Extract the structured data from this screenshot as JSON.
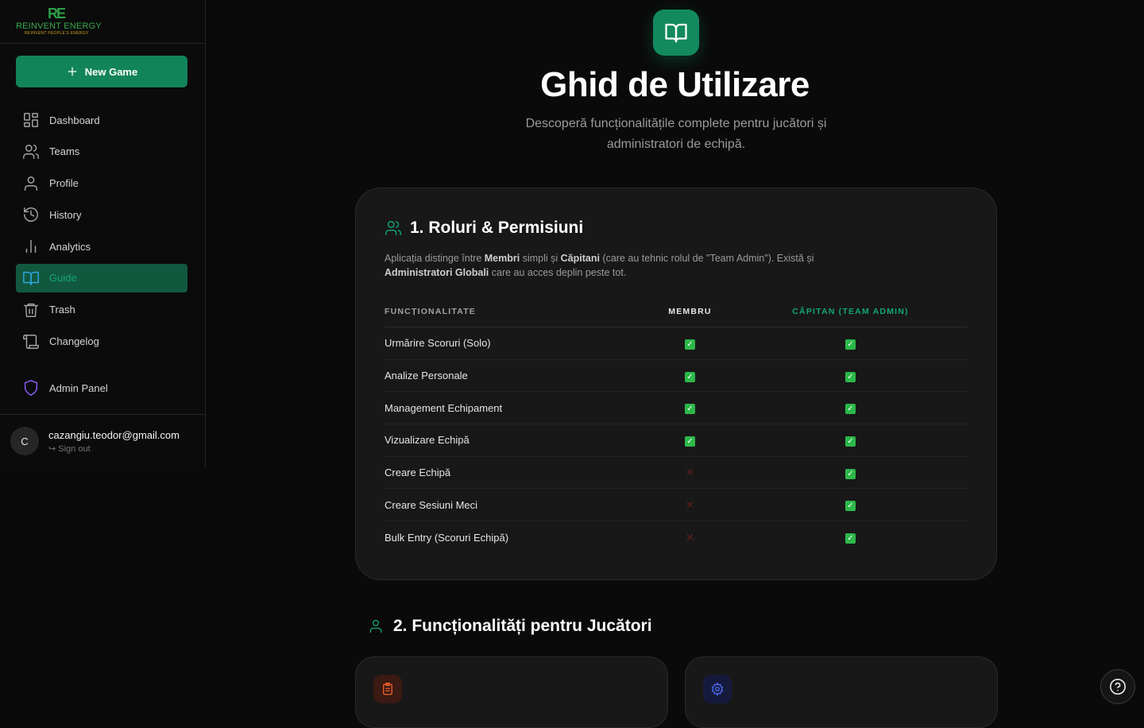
{
  "brand": {
    "mark": "RE",
    "name": "REINVENT ENERGY",
    "tagline": "REINVENT PEOPLE'S ENERGY"
  },
  "sidebar": {
    "new_game_label": "New Game",
    "items": [
      {
        "label": "Dashboard",
        "icon": "grid-icon"
      },
      {
        "label": "Teams",
        "icon": "users-icon"
      },
      {
        "label": "Profile",
        "icon": "user-icon"
      },
      {
        "label": "History",
        "icon": "history-icon"
      },
      {
        "label": "Analytics",
        "icon": "bar-chart-icon"
      },
      {
        "label": "Guide",
        "icon": "book-icon",
        "active": true
      },
      {
        "label": "Trash",
        "icon": "trash-icon"
      },
      {
        "label": "Changelog",
        "icon": "scroll-icon"
      }
    ],
    "admin_label": "Admin Panel",
    "user": {
      "initial": "C",
      "email": "cazangiu.teodor@gmail.com",
      "signout": "Sign out"
    }
  },
  "hero": {
    "title": "Ghid de Utilizare",
    "subtitle": "Descoperă funcționalitățile complete pentru jucători și administratori de echipă."
  },
  "roles": {
    "heading": "1. Roluri & Permisiuni",
    "intro_1": "Aplicația distinge între ",
    "intro_membri": "Membri",
    "intro_2": " simpli și ",
    "intro_capitani": "Căpitani",
    "intro_3": " (care au tehnic rolul de \"Team Admin\"). Există și ",
    "intro_admins": "Administratori Globali",
    "intro_4": " care au acces deplin peste tot.",
    "columns": [
      "FUNCȚIONALITATE",
      "MEMBRU",
      "CĂPITAN (TEAM ADMIN)"
    ],
    "rows": [
      {
        "feature": "Urmărire Scoruri (Solo)",
        "member": true,
        "captain": true
      },
      {
        "feature": "Analize Personale",
        "member": true,
        "captain": true
      },
      {
        "feature": "Management Echipament",
        "member": true,
        "captain": true
      },
      {
        "feature": "Vizualizare Echipă",
        "member": true,
        "captain": true
      },
      {
        "feature": "Creare Echipă",
        "member": false,
        "captain": true
      },
      {
        "feature": "Creare Sesiuni Meci",
        "member": false,
        "captain": true
      },
      {
        "feature": "Bulk Entry (Scoruri Echipă)",
        "member": false,
        "captain": true
      }
    ]
  },
  "players": {
    "heading": "2. Funcționalități pentru Jucători"
  },
  "colors": {
    "accent": "#12845a",
    "accent_text": "#12a57a",
    "admin": "#8b5cf6",
    "yes": "#2db84a",
    "no": "#5c1d1d"
  }
}
